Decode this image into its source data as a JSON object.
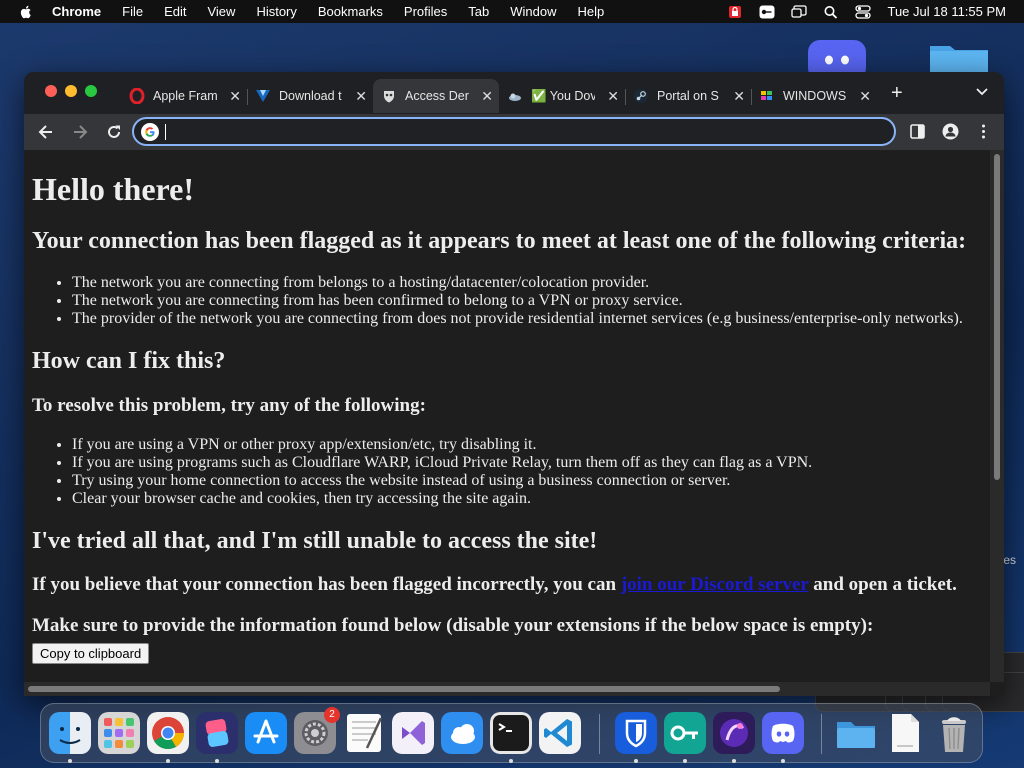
{
  "menubar": {
    "app_name": "Chrome",
    "items": [
      "File",
      "Edit",
      "View",
      "History",
      "Bookmarks",
      "Profiles",
      "Tab",
      "Window",
      "Help"
    ],
    "clock": "Tue Jul 18  11:55 PM"
  },
  "desktop": {
    "partial_label": "es"
  },
  "tabs": [
    {
      "title": "Apple Fram",
      "icon": "opera-icon"
    },
    {
      "title": "Download t",
      "icon": "vuetify-icon"
    },
    {
      "title": "Access Der",
      "icon": "mask-icon"
    },
    {
      "title": "✅ You Dov",
      "icon": "cloud-icon"
    },
    {
      "title": "Portal on S",
      "icon": "steam-icon"
    },
    {
      "title": "WINDOWS",
      "icon": "windows-app-icon"
    }
  ],
  "omnibox": {
    "value": "",
    "placeholder": ""
  },
  "page": {
    "h1": "Hello there!",
    "h2_flagged": "Your connection has been flagged as it appears to meet at least one of the following criteria:",
    "criteria": [
      "The network you are connecting from belongs to a hosting/datacenter/colocation provider.",
      "The network you are connecting from has been confirmed to belong to a VPN or proxy service.",
      "The provider of the network you are connecting from does not provide residential internet services (e.g business/enterprise-only networks)."
    ],
    "h2_fix": "How can I fix this?",
    "h3_resolve": "To resolve this problem, try any of the following:",
    "fixes": [
      "If you are using a VPN or other proxy app/extension/etc, try disabling it.",
      "If you are using programs such as Cloudflare WARP, iCloud Private Relay, turn them off as they can flag as a VPN.",
      "Try using your home connection to access the website instead of using a business connection or server.",
      "Clear your browser cache and cookies, then try accessing the site again."
    ],
    "h2_tried": "I've tried all that, and I'm still unable to access the site!",
    "incorrect_prefix": "If you believe that your connection has been flagged incorrectly, you can",
    "discord_link": "join our Discord server",
    "incorrect_suffix": "and open a ticket.",
    "provide_info": "Make sure to provide the information found below (disable your extensions if the below space is empty):",
    "copy_button": "Copy to clipboard"
  },
  "dock": {
    "settings_badge": "2",
    "apps": [
      "finder-icon",
      "launchpad-icon",
      "chrome-icon",
      "shortcuts-icon",
      "app-store-icon",
      "system-settings-icon",
      "textedit-icon",
      "visual-studio-icon",
      "weather-icon",
      "terminal-icon",
      "vscode-icon",
      "bitwarden-icon",
      "authenticator-icon",
      "dev-app-icon",
      "discord-icon",
      "folder-icon",
      "document-icon",
      "trash-icon"
    ]
  },
  "colors": {
    "omnibox_focus": "#8ab4f8",
    "link": "#1a1ad0",
    "traffic_close": "#ff5f57",
    "traffic_min": "#febc2e",
    "traffic_max": "#28c840"
  }
}
